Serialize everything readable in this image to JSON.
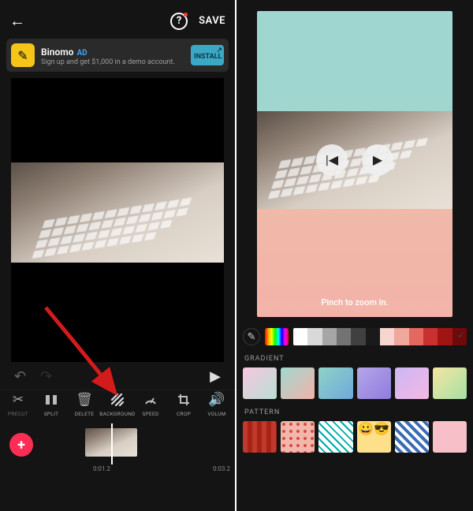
{
  "left": {
    "topbar": {
      "save_label": "SAVE"
    },
    "ad": {
      "title": "Binomo",
      "badge": "AD",
      "subtitle": "Sign up and get $1,000 in a demo account.",
      "install_label": "INSTALL"
    },
    "toolbar": [
      {
        "name": "precut",
        "label": "PRECUT"
      },
      {
        "name": "split",
        "label": "SPLIT"
      },
      {
        "name": "delete",
        "label": "DELETE"
      },
      {
        "name": "background",
        "label": "BACKGROUND"
      },
      {
        "name": "speed",
        "label": "SPEED"
      },
      {
        "name": "crop",
        "label": "CROP"
      },
      {
        "name": "volume",
        "label": "VOLUM"
      }
    ],
    "timeline": {
      "current": "0:01.2",
      "duration": "0:03.2"
    }
  },
  "right": {
    "hint": "Pinch to zoom in.",
    "solid_colors": [
      "#ffffff",
      "#d9d9d9",
      "#a6a6a6",
      "#737373",
      "#404040",
      "#1a1a1a",
      "#f7d6d0",
      "#f0a79c",
      "#e4685f",
      "#c93030",
      "#a01414",
      "#6e0a0a"
    ],
    "sections": {
      "gradient_label": "GRADIENT",
      "pattern_label": "PATTERN"
    },
    "gradients": [
      "linear-gradient(135deg,#f7c6e0,#b8e0d2)",
      "linear-gradient(135deg,#a0d8d0,#f3b3a9)",
      "linear-gradient(135deg,#8fd3c7,#6fa8dc)",
      "linear-gradient(135deg,#b6a6e8,#8f7be0)",
      "linear-gradient(135deg,#cbb7f5,#f5b7e3)",
      "linear-gradient(135deg,#f5e6a3,#a6e0a3)"
    ],
    "patterns": [
      {
        "name": "stripes-red",
        "bg": "repeating-linear-gradient(90deg,#c0392b 0 6px,#a82315 6px 12px)"
      },
      {
        "name": "dots-red",
        "bg": "radial-gradient(circle at 4px 4px,#d64e3f 2px,transparent 2px) 0 0/9px 9px,#f3b6ad"
      },
      {
        "name": "diamonds-teal",
        "bg": "repeating-linear-gradient(45deg,#ffffff 0 5px,#0aa 5px 7px),repeating-linear-gradient(-45deg,transparent 0 5px,#0aa 5px 7px)"
      },
      {
        "name": "emoji",
        "bg": "linear-gradient(#ffe08a,#ffe08a)"
      },
      {
        "name": "crosshatch-blue",
        "bg": "repeating-linear-gradient(45deg,#fff 0 4px,#3b6db5 4px 8px),repeating-linear-gradient(-45deg,transparent 0 4px,#3b6db5 4px 8px)"
      },
      {
        "name": "pink",
        "bg": "linear-gradient(#f7bfc8,#f7bfc8)"
      }
    ]
  }
}
